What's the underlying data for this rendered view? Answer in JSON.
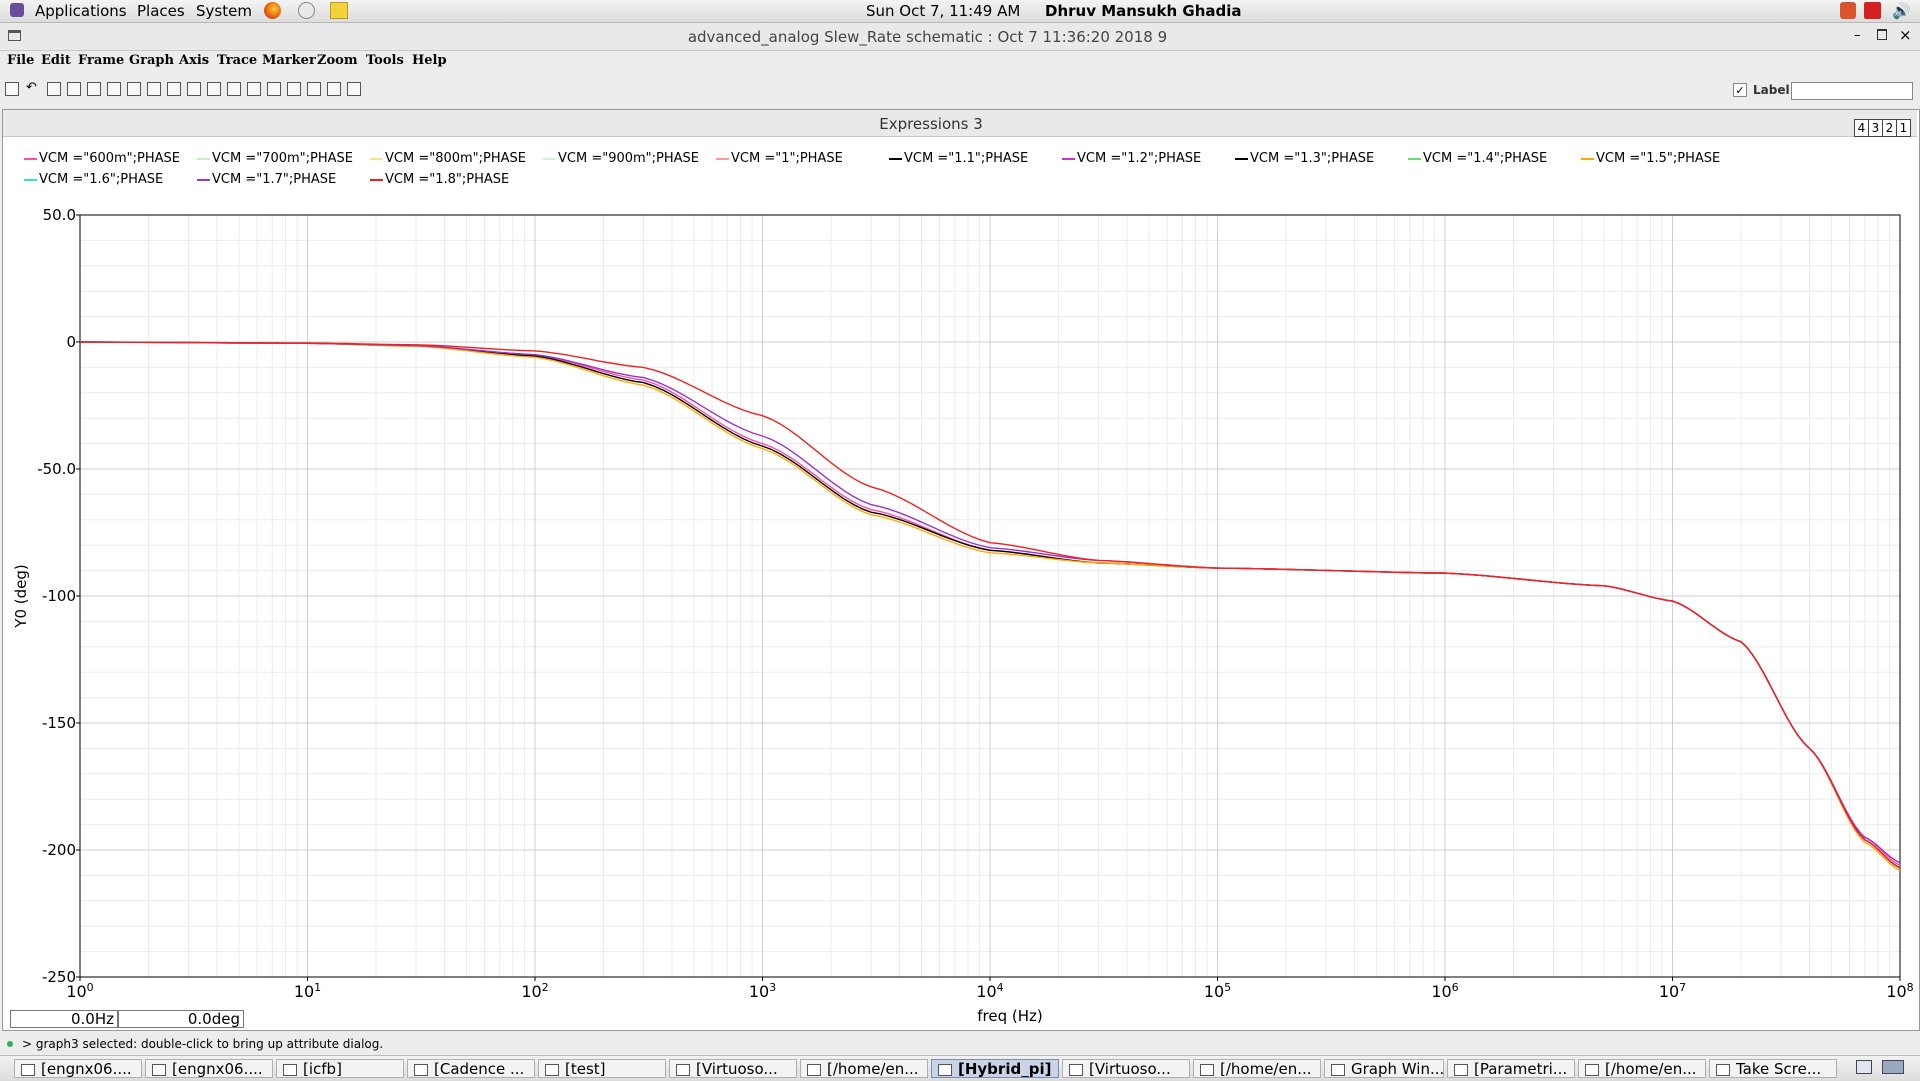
{
  "top_panel": {
    "applications": "Applications",
    "places": "Places",
    "system": "System",
    "clock": "Sun Oct  7, 11:49 AM",
    "user": "Dhruv Mansukh Ghadia"
  },
  "window": {
    "title": "advanced_analog Slew_Rate schematic : Oct  7 11:36:20 2018 9"
  },
  "menu": [
    "File",
    "Edit",
    "Frame",
    "Graph",
    "Axis",
    "Trace",
    "Marker",
    "Zoom",
    "Tools",
    "Help"
  ],
  "toolbar": {
    "label_checkbox": "Label",
    "label_value": ""
  },
  "graph": {
    "title": "Expressions 3",
    "subwindows": [
      "4",
      "3",
      "2",
      "1"
    ],
    "xlabel": "freq (Hz)",
    "ylabel": "Y0 (deg)",
    "readout_x": "0.0Hz",
    "readout_y": "0.0deg"
  },
  "legend": [
    {
      "name": "VCM =\"600m\";PHASE",
      "color": "#ff4da6"
    },
    {
      "name": "VCM =\"700m\";PHASE",
      "color": "#c8f0c8"
    },
    {
      "name": "VCM =\"800m\";PHASE",
      "color": "#f0e68c"
    },
    {
      "name": "VCM =\"900m\";PHASE",
      "color": "#d0f0d0"
    },
    {
      "name": "VCM =\"1\";PHASE",
      "color": "#ff9999"
    },
    {
      "name": "VCM =\"1.1\";PHASE",
      "color": "#000000"
    },
    {
      "name": "VCM =\"1.2\";PHASE",
      "color": "#cc33cc"
    },
    {
      "name": "VCM =\"1.3\";PHASE",
      "color": "#000000"
    },
    {
      "name": "VCM =\"1.4\";PHASE",
      "color": "#66dd66"
    },
    {
      "name": "VCM =\"1.5\";PHASE",
      "color": "#ffaa00"
    },
    {
      "name": "VCM =\"1.6\";PHASE",
      "color": "#33dddd"
    },
    {
      "name": "VCM =\"1.7\";PHASE",
      "color": "#9933cc"
    },
    {
      "name": "VCM =\"1.8\";PHASE",
      "color": "#ee2222"
    }
  ],
  "chart_data": {
    "type": "line",
    "xlabel": "freq (Hz)",
    "ylabel": "Y0 (deg)",
    "xscale": "log",
    "xlim": [
      1,
      100000000
    ],
    "ylim": [
      -250,
      50
    ],
    "y_ticks": [
      "50.0",
      "0",
      "-50.0",
      "-100",
      "-150",
      "-200",
      "-250"
    ],
    "x_ticks": [
      {
        "base": "10",
        "exp": "0"
      },
      {
        "base": "10",
        "exp": "1"
      },
      {
        "base": "10",
        "exp": "2"
      },
      {
        "base": "10",
        "exp": "3"
      },
      {
        "base": "10",
        "exp": "4"
      },
      {
        "base": "10",
        "exp": "5"
      },
      {
        "base": "10",
        "exp": "6"
      },
      {
        "base": "10",
        "exp": "7"
      },
      {
        "base": "10",
        "exp": "8"
      }
    ],
    "grid": true,
    "series": [
      {
        "name": "VCM =\"600m\";PHASE",
        "color": "#ff4da6",
        "x": [
          1,
          10,
          30,
          100,
          300,
          1000,
          3000,
          10000,
          30000,
          100000,
          1000000,
          5000000,
          10000000,
          20000000,
          40000000,
          70000000,
          100000000
        ],
        "y": [
          0,
          -0.5,
          -1.5,
          -5,
          -15,
          -40,
          -66,
          -82,
          -87,
          -89,
          -91,
          -96,
          -102,
          -118,
          -160,
          -195,
          -206
        ]
      },
      {
        "name": "VCM =\"900m\";PHASE",
        "color": "#000000",
        "x": [
          1,
          10,
          30,
          100,
          300,
          1000,
          3000,
          10000,
          30000,
          100000,
          1000000,
          5000000,
          10000000,
          20000000,
          40000000,
          70000000,
          100000000
        ],
        "y": [
          0,
          -0.5,
          -1.6,
          -5.5,
          -16,
          -41,
          -67,
          -82,
          -87,
          -89,
          -91,
          -96,
          -102,
          -118,
          -160,
          -196,
          -207
        ]
      },
      {
        "name": "VCM =\"1.5\";PHASE",
        "color": "#ffaa00",
        "x": [
          1,
          10,
          30,
          100,
          300,
          1000,
          3000,
          10000,
          30000,
          100000,
          1000000,
          5000000,
          10000000,
          20000000,
          40000000,
          70000000,
          100000000
        ],
        "y": [
          0,
          -0.5,
          -1.7,
          -6,
          -17,
          -42,
          -68,
          -83,
          -87,
          -89,
          -91,
          -96,
          -102,
          -118,
          -160,
          -197,
          -208
        ]
      },
      {
        "name": "VCM =\"1.7\";PHASE",
        "color": "#9933cc",
        "x": [
          1,
          10,
          30,
          100,
          300,
          1000,
          3000,
          10000,
          30000,
          100000,
          1000000,
          5000000,
          10000000,
          20000000,
          40000000,
          70000000,
          100000000
        ],
        "y": [
          0,
          -0.5,
          -1.4,
          -5,
          -14,
          -37,
          -64,
          -81,
          -86,
          -89,
          -91,
          -96,
          -102,
          -118,
          -160,
          -195,
          -205
        ]
      },
      {
        "name": "VCM =\"1.8\";PHASE",
        "color": "#ee2222",
        "x": [
          1,
          10,
          30,
          100,
          300,
          1000,
          3000,
          10000,
          30000,
          100000,
          1000000,
          5000000,
          10000000,
          20000000,
          40000000,
          70000000,
          100000000
        ],
        "y": [
          0,
          -0.4,
          -1.1,
          -3.5,
          -10,
          -29,
          -57,
          -79,
          -86,
          -89,
          -91,
          -96,
          -102,
          -118,
          -160,
          -196,
          -207
        ]
      }
    ]
  },
  "status": {
    "message": "> graph3 selected: double-click to bring up attribute dialog."
  },
  "taskbar": [
    {
      "label": "[engnx06...."
    },
    {
      "label": "[engnx06...."
    },
    {
      "label": "[icfb]"
    },
    {
      "label": "[Cadence ..."
    },
    {
      "label": "[test]"
    },
    {
      "label": "[Virtuoso..."
    },
    {
      "label": "[/home/en..."
    },
    {
      "label": "[Hybrid_pi]",
      "active": true
    },
    {
      "label": "[Virtuoso..."
    },
    {
      "label": "[/home/en..."
    },
    {
      "label": "Graph Win..."
    },
    {
      "label": "[Parametri..."
    },
    {
      "label": "[/home/en..."
    },
    {
      "label": "Take Scre..."
    }
  ]
}
